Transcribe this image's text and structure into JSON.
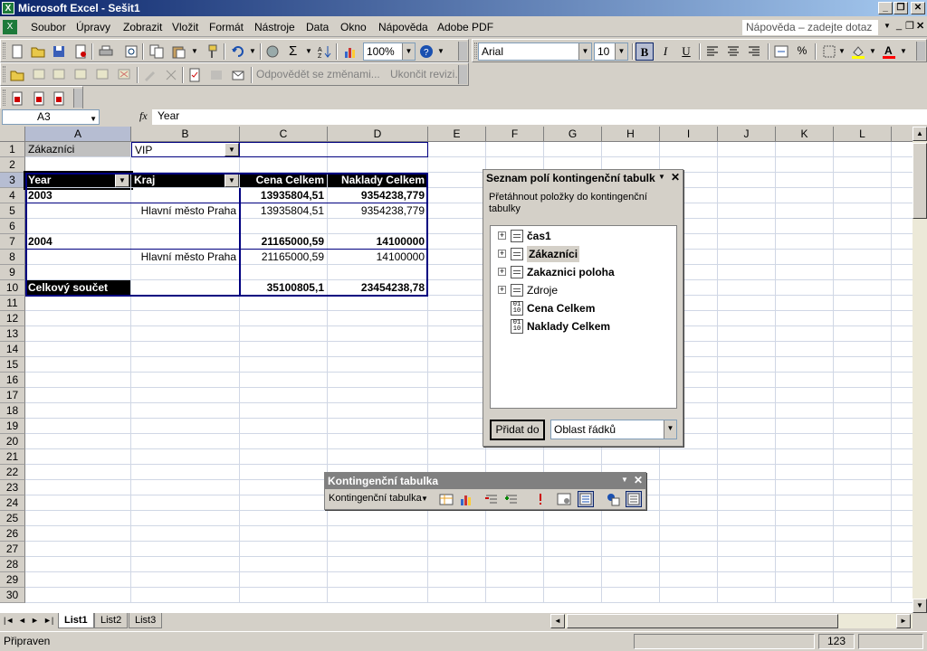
{
  "window": {
    "title": "Microsoft Excel - Sešit1"
  },
  "menu": {
    "items": [
      "Soubor",
      "Úpravy",
      "Zobrazit",
      "Vložit",
      "Formát",
      "Nástroje",
      "Data",
      "Okno",
      "Nápověda",
      "Adobe PDF"
    ],
    "help_placeholder": "Nápověda – zadejte dotaz"
  },
  "toolbar": {
    "zoom": "100%",
    "font": "Arial",
    "size": "10",
    "bold": "B",
    "italic": "I",
    "underline": "U",
    "percent": "%",
    "sigma": "Σ"
  },
  "review_toolbar": {
    "reply": "Odpovědět se změnami...",
    "end_review": "Ukončit revizi..."
  },
  "formula": {
    "cell_ref": "A3",
    "fx": "fx",
    "value": "Year"
  },
  "columns": [
    "A",
    "B",
    "C",
    "D",
    "E",
    "F",
    "G",
    "H",
    "I",
    "J",
    "K",
    "L"
  ],
  "rows": [
    "1",
    "2",
    "3",
    "4",
    "5",
    "6",
    "7",
    "8",
    "9",
    "10",
    "11",
    "12",
    "13",
    "14",
    "15",
    "16",
    "17",
    "18",
    "19",
    "20",
    "21",
    "22",
    "23",
    "24",
    "25",
    "26",
    "27",
    "28",
    "29",
    "30"
  ],
  "pivot": {
    "page_field": "Zákazníci",
    "page_value": "VIP",
    "headers": [
      "Year",
      "Kraj",
      "Cena Celkem",
      "Naklady Celkem"
    ],
    "year_2003": "2003",
    "val_2003_c": "13935804,51",
    "val_2003_d": "9354238,779",
    "kraj_1": "Hlavní město Praha",
    "sub_2003_c": "13935804,51",
    "sub_2003_d": "9354238,779",
    "year_2004": "2004",
    "val_2004_c": "21165000,59",
    "val_2004_d": "14100000",
    "kraj_2": "Hlavní město Praha",
    "sub_2004_c": "21165000,59",
    "sub_2004_d": "14100000",
    "total_label": "Celkový součet",
    "total_c": "35100805,1",
    "total_d": "23454238,78"
  },
  "field_list": {
    "title": "Seznam polí kontingenční tabulky",
    "instruction": "Přetáhnout položky do kontingenční tabulky",
    "fields": [
      "čas1",
      "Zákazníci",
      "Zakaznici poloha",
      "Zdroje",
      "Cena Celkem",
      "Naklady Celkem"
    ],
    "add_button": "Přidat do",
    "area_select": "Oblast řádků"
  },
  "pivot_toolbar": {
    "title": "Kontingenční tabulka",
    "menu": "Kontingenční tabulka"
  },
  "sheets": [
    "List1",
    "List2",
    "List3"
  ],
  "status": {
    "text": "Připraven",
    "num": "123"
  },
  "colors": {
    "title_start": "#0a246a",
    "title_end": "#a6caf0",
    "pivot_header": "#000000",
    "pivot_border": "#000080"
  }
}
